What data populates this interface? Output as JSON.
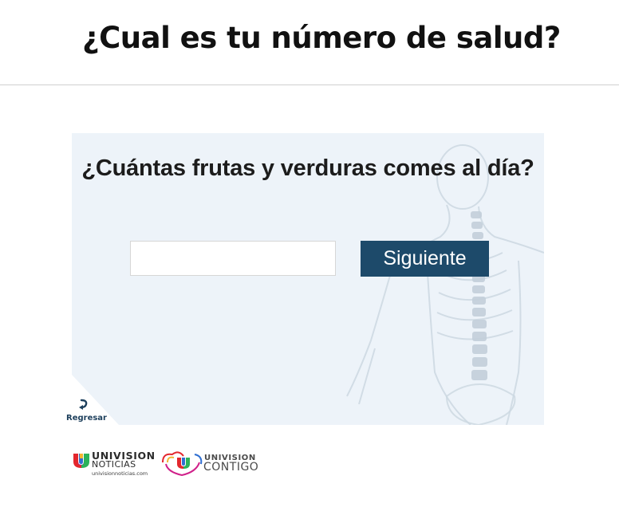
{
  "header": {
    "title": "¿Cual es tu número de salud?"
  },
  "quiz": {
    "question": "¿Cuántas frutas y verduras comes al día?",
    "answer_value": "",
    "answer_placeholder": "",
    "next_label": "Siguiente",
    "back_label": "Regresar"
  },
  "footer": {
    "logo1_brand": "UNIVISION",
    "logo1_sub": "NOTICIAS",
    "logo1_url": "univisionnoticias.com",
    "logo2_brand": "UNIVISION",
    "logo2_sub": "CONTIGO"
  },
  "colors": {
    "button": "#1d4a6a",
    "panel_bg": "#edf3f9",
    "back_label": "#1d3f5c"
  },
  "icons": [
    "anatomy-illustration",
    "back-arrow-icon",
    "univision-logo-icon",
    "heart-swirl-icon"
  ]
}
